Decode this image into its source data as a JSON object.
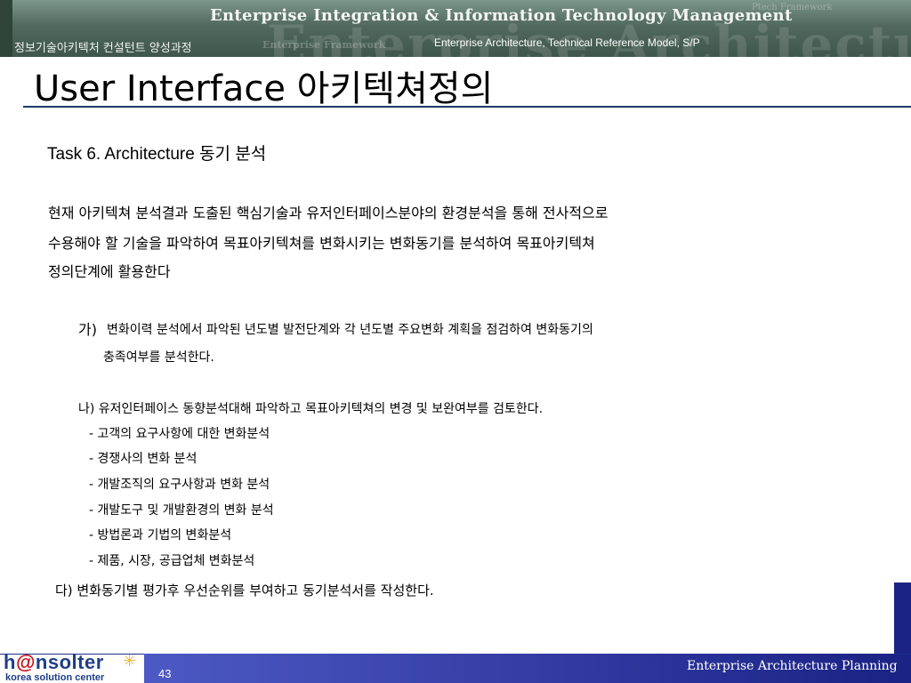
{
  "header": {
    "main_title": "Enterprise Integration & Information Technology Management",
    "left_caption": "정보기술아키텍처 컨설턴트 양성과정",
    "right_caption": "Enterprise Architecture, Technical Reference Model, S/P",
    "watermark": "Enterprise Architecture Mod",
    "watermark_small": "Enterprise Framework",
    "watermark_corner": "Ptech Framework"
  },
  "slide": {
    "title": "User Interface 아키텍쳐정의",
    "task_heading": "Task 6. Architecture 동기 분석",
    "intro": [
      "현재 아키텍쳐 분석결과 도출된 핵심기술과 유저인터페이스분야의 환경분석을 통해 전사적으로",
      "수용해야 할 기술을 파악하여 목표아키텍쳐를 변화시키는 변화동기를 분석하여 목표아키텍쳐",
      "정의단계에 활용한다"
    ],
    "item_ga": {
      "marker": "가)",
      "line1": "변화이력 분석에서 파악된 년도별 발전단계와 각 년도별 주요변화 계획을 점검하여 변화동기의",
      "line2": "충족여부를  분석한다."
    },
    "item_na": {
      "text": "나)  유저인터페이스 동향분석대해 파악하고  목표아키텍쳐의 변경 및 보완여부를 검토한다."
    },
    "sub_items": [
      "-  고객의 요구사항에 대한 변화분석",
      "-  경쟁사의 변화 분석",
      "-  개발조직의 요구사항과 변화 분석",
      "-  개발도구 및 개발환경의 변화 분석",
      "-  방법론과 기법의 변화분석",
      "-  제품, 시장, 공급업체 변화분석"
    ],
    "item_da": {
      "text": "다) 변화동기별 평가후 우선순위를 부여하고 동기분석서를 작성한다."
    }
  },
  "footer": {
    "logo_prefix": "h",
    "logo_at": "@",
    "logo_suffix": "nsolter",
    "logo_sub": "korea solution center",
    "page_number": "43",
    "right_text": "Enterprise Architecture Planning"
  },
  "colors": {
    "banner": "#51695e",
    "rule": "#1e3a6b",
    "footer_bar": "#1b2385",
    "logo_blue": "#1e3d8a",
    "logo_red": "#c8101a"
  },
  "icons": {
    "logo_star": "star-burst-icon"
  }
}
